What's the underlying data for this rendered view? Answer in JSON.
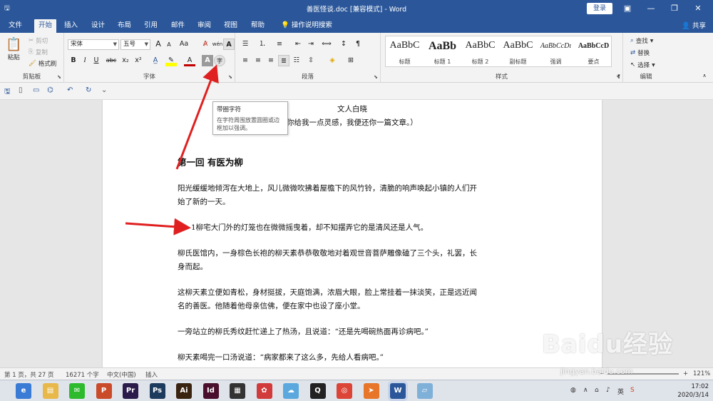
{
  "titlebar": {
    "title": "善医怪谈.doc [兼容模式] - Word",
    "login": "登录",
    "qat_icons": [
      "save-icon",
      "undo-icon",
      "redo-icon"
    ]
  },
  "tabs": [
    "文件",
    "开始",
    "插入",
    "设计",
    "布局",
    "引用",
    "邮件",
    "审阅",
    "视图",
    "帮助"
  ],
  "active_tab": "开始",
  "tell_me": "操作说明搜索",
  "share": "共享",
  "clipboard": {
    "paste": "粘贴",
    "cut": "剪切",
    "copy": "复制",
    "format_painter": "格式刷",
    "label": "剪贴板"
  },
  "font": {
    "family": "宋体",
    "size": "五号",
    "grow": "A",
    "shrink": "A",
    "case": "Aa",
    "label": "字体",
    "bold": "B",
    "italic": "I",
    "underline": "U",
    "strike": "abc",
    "subscript": "x₂",
    "superscript": "x²",
    "phonetic": "wén",
    "border_char": "A",
    "shading_char": "A",
    "circle_char": "字"
  },
  "paragraph": {
    "label": "段落"
  },
  "styles": {
    "label": "样式",
    "items": [
      {
        "sample": "AaBbC",
        "name": "标题"
      },
      {
        "sample": "AaBb",
        "name": "标题 1"
      },
      {
        "sample": "AaBbC",
        "name": "标题 2"
      },
      {
        "sample": "AaBbC",
        "name": "副标题"
      },
      {
        "sample": "AaBbCcDı",
        "name": "强调"
      },
      {
        "sample": "AaBbCcD",
        "name": "要点"
      }
    ]
  },
  "editing": {
    "find": "查找",
    "replace": "替换",
    "select": "选择",
    "label": "编辑"
  },
  "tooltip": {
    "title": "带圈字符",
    "desc": "在字符周围放置圆圈或边框加以强调。"
  },
  "document": {
    "author_line": "文人白晓",
    "subtitle_line": "你给我一点灵感，我便还你一篇文章。）",
    "heading": "第一回  有医为柳",
    "paragraphs": [
      "阳光缓缓地倾泻在大地上，风儿微微吹拂着屋檐下的风竹铃，清脆的响声唤起小镇的人们开",
      "始了新的一天。",
      "1柳宅大门外的灯笼也在微微摇曳着，却不知摆弄它的是清风还是人气。",
      "柳氏医馆内，一身棕色长袍的柳天素恭恭敬敬地对着观世音菩萨雕像磕了三个头，礼罢，长",
      "身而起。",
      "这柳天素立便如青松，身材挺拔，天庭饱满，浓眉大眼，脸上常挂着一抹淡笑，正是远近闻",
      "名的善医。他随着他母亲信佛，便在家中也设了座小堂。",
      "一旁站立的柳氏秀纹赶忙递上了热汤，且说道：“还是先喝碗热面再诊病吧。”",
      "柳天素喝完一口汤说道：“病家都来了这么多，先给人看病吧。”"
    ]
  },
  "status": {
    "page": "第 1 页，共 27 页",
    "words": "16271 个字",
    "language": "中文(中国)",
    "mode": "插入",
    "zoom": "121%"
  },
  "taskbar": {
    "apps": [
      {
        "name": "browser-360-icon",
        "label": "e",
        "color": "#3a7bd5"
      },
      {
        "name": "file-explorer-icon",
        "label": "▤",
        "color": "#e8b94a"
      },
      {
        "name": "wechat-icon",
        "label": "✉",
        "color": "#2dbb2d"
      },
      {
        "name": "powerpoint-icon",
        "label": "P",
        "color": "#c94b2a"
      },
      {
        "name": "premiere-icon",
        "label": "Pr",
        "color": "#2a1b4a"
      },
      {
        "name": "photoshop-icon",
        "label": "Ps",
        "color": "#1d3b5c"
      },
      {
        "name": "illustrator-icon",
        "label": "Ai",
        "color": "#3a2410"
      },
      {
        "name": "indesign-icon",
        "label": "Id",
        "color": "#4a0f2c"
      },
      {
        "name": "video-editor-icon",
        "label": "▦",
        "color": "#333333"
      },
      {
        "name": "image-viewer-icon",
        "label": "✿",
        "color": "#d13b3b"
      },
      {
        "name": "chat-app-icon",
        "label": "☁",
        "color": "#5aa8de"
      },
      {
        "name": "qq-icon",
        "label": "Q",
        "color": "#222222"
      },
      {
        "name": "chrome-icon",
        "label": "◎",
        "color": "#db4437"
      },
      {
        "name": "foxmail-icon",
        "label": "➤",
        "color": "#e8762a"
      },
      {
        "name": "word-icon",
        "label": "W",
        "color": "#2b579a"
      },
      {
        "name": "notes-icon",
        "label": "▱",
        "color": "#7fb0d8"
      }
    ],
    "time": "17:02",
    "date": "2020/3/14"
  },
  "watermark": {
    "main": "Baidu经验",
    "sub": "jingyan.baidu.com"
  },
  "colors": {
    "accent": "#2b579a",
    "arrow": "#e02020"
  }
}
